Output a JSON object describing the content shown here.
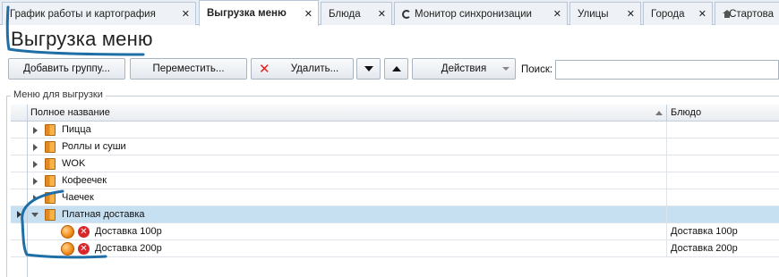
{
  "tabs": [
    {
      "label": "График работы и картография",
      "active": false,
      "icon": ""
    },
    {
      "label": "Выгрузка меню",
      "active": true,
      "icon": ""
    },
    {
      "label": "Блюда",
      "active": false,
      "icon": ""
    },
    {
      "label": "Монитор синхронизации",
      "active": false,
      "icon": "sync-spinner-icon"
    },
    {
      "label": "Улицы",
      "active": false,
      "icon": ""
    },
    {
      "label": "Города",
      "active": false,
      "icon": ""
    },
    {
      "label": "Стартова",
      "active": false,
      "icon": "home-icon"
    }
  ],
  "tab_close_glyph": "✕",
  "page_title": "Выгрузка меню",
  "toolbar": {
    "add_group": "Добавить группу...",
    "move": "Переместить...",
    "delete": "Удалить...",
    "actions": "Действия",
    "search_label": "Поиск:",
    "search_value": ""
  },
  "group_label": "Меню для выгрузки",
  "grid": {
    "columns": [
      "Полное название",
      "Блюдо"
    ],
    "rows": [
      {
        "name": "Пицца",
        "dish": "",
        "kind": "group",
        "expanded": false,
        "selected": false
      },
      {
        "name": "Роллы и суши",
        "dish": "",
        "kind": "group",
        "expanded": false,
        "selected": false
      },
      {
        "name": "WOK",
        "dish": "",
        "kind": "group",
        "expanded": false,
        "selected": false
      },
      {
        "name": "Кофеечек",
        "dish": "",
        "kind": "group",
        "expanded": false,
        "selected": false
      },
      {
        "name": "Чаечек",
        "dish": "",
        "kind": "group",
        "expanded": false,
        "selected": false
      },
      {
        "name": "Платная доставка",
        "dish": "",
        "kind": "group",
        "expanded": true,
        "selected": true
      },
      {
        "name": "Доставка 100р",
        "dish": "Доставка 100р",
        "kind": "item",
        "selected": false
      },
      {
        "name": "Доставка 200р",
        "dish": "Доставка 200р",
        "kind": "item",
        "selected": false
      }
    ]
  },
  "colors": {
    "selection": "#c6dff1",
    "annotation": "#1f6fa6",
    "delete_x": "#d9262b",
    "folder": "#f7b24a"
  }
}
